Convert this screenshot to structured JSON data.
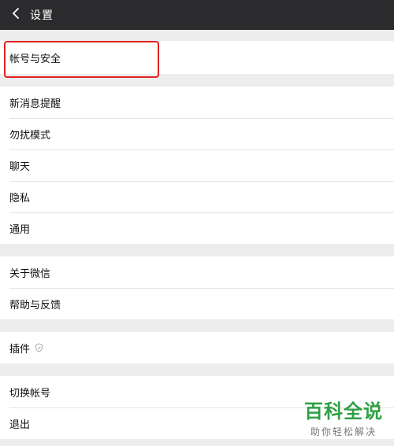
{
  "header": {
    "title": "设置",
    "back_icon": "chevron-left-icon"
  },
  "groups": [
    {
      "items": [
        {
          "label": "帐号与安全"
        }
      ]
    },
    {
      "items": [
        {
          "label": "新消息提醒"
        },
        {
          "label": "勿扰模式"
        },
        {
          "label": "聊天"
        },
        {
          "label": "隐私"
        },
        {
          "label": "通用"
        }
      ]
    },
    {
      "items": [
        {
          "label": "关于微信"
        },
        {
          "label": "帮助与反馈"
        }
      ]
    },
    {
      "items": [
        {
          "label": "插件",
          "icon": "shield-icon"
        }
      ]
    },
    {
      "items": [
        {
          "label": "切换帐号"
        },
        {
          "label": "退出"
        }
      ]
    }
  ],
  "watermark": {
    "brand": "百科全说",
    "slogan": "助你轻松解决"
  },
  "colors": {
    "header_bg": "#2b2b2d",
    "highlight": "#e02020",
    "watermark": "#2ea043"
  }
}
